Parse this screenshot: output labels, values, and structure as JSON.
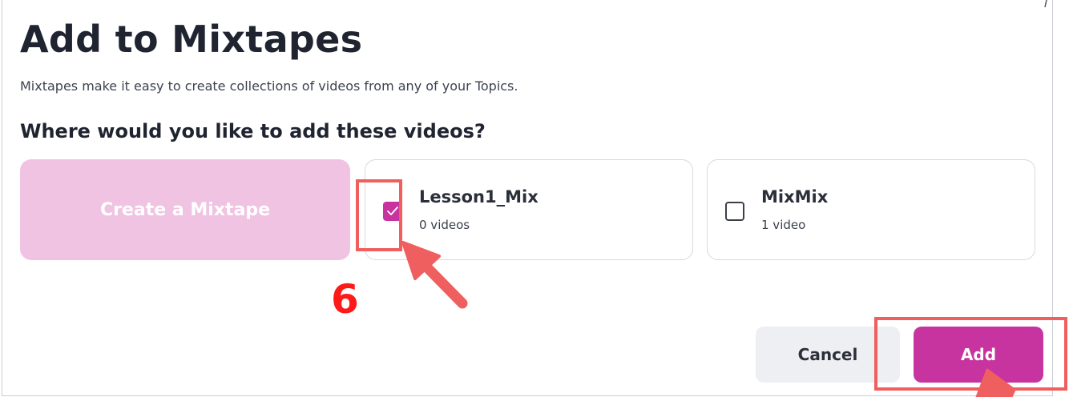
{
  "dialog": {
    "title": "Add to Mixtapes",
    "subtitle": "Mixtapes make it easy to create collections of videos from any of your Topics.",
    "question": "Where would you like to add these videos?",
    "create_label": "Create a Mixtape",
    "mixtapes": [
      {
        "name": "Lesson1_Mix",
        "count": "0 videos",
        "checked": true
      },
      {
        "name": "MixMix",
        "count": "1 video",
        "checked": false
      }
    ],
    "cancel_label": "Cancel",
    "add_label": "Add"
  },
  "annotations": {
    "step_number": "6"
  },
  "colors": {
    "accent": "#c8349f",
    "create_bg": "#f0c3e2",
    "annotation_red": "#ef5f5f",
    "step_red": "#ff1a1a"
  }
}
